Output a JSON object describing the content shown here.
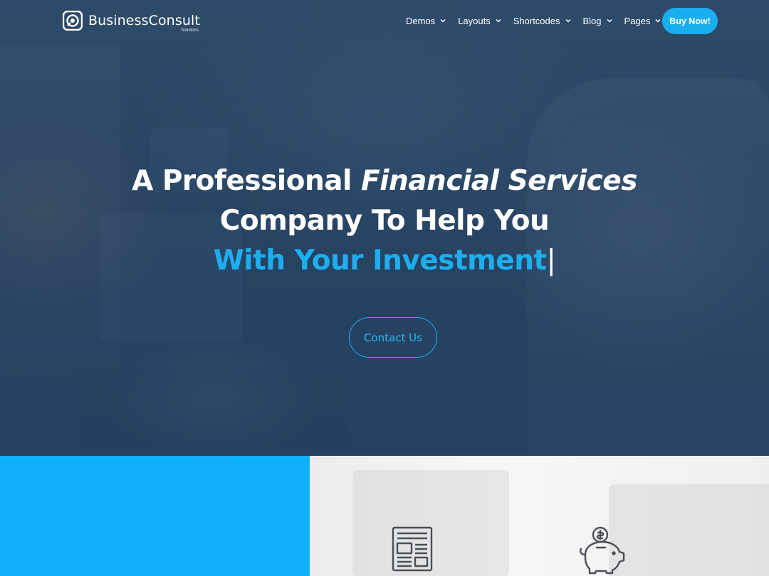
{
  "brand": {
    "name": "BusinessConsult",
    "subtitle": "Solutions"
  },
  "nav": {
    "items": [
      {
        "label": "Demos"
      },
      {
        "label": "Layouts"
      },
      {
        "label": "Shortcodes"
      },
      {
        "label": "Blog"
      },
      {
        "label": "Pages"
      }
    ],
    "cta_label": "Buy Now!"
  },
  "hero": {
    "line1_plain": "A Professional",
    "line1_italic": "Financial Services",
    "line2": "Company To Help You",
    "line3": "With Your Investment",
    "cursor": "|",
    "contact_label": "Contact Us"
  },
  "colors": {
    "accent": "#19aef0",
    "lower_panel": "#0fb0f8",
    "hero_overlay": "#2f4a66"
  },
  "icons": [
    "logo-icon",
    "chevron-down-icon",
    "newspaper-icon",
    "piggy-bank-icon"
  ]
}
